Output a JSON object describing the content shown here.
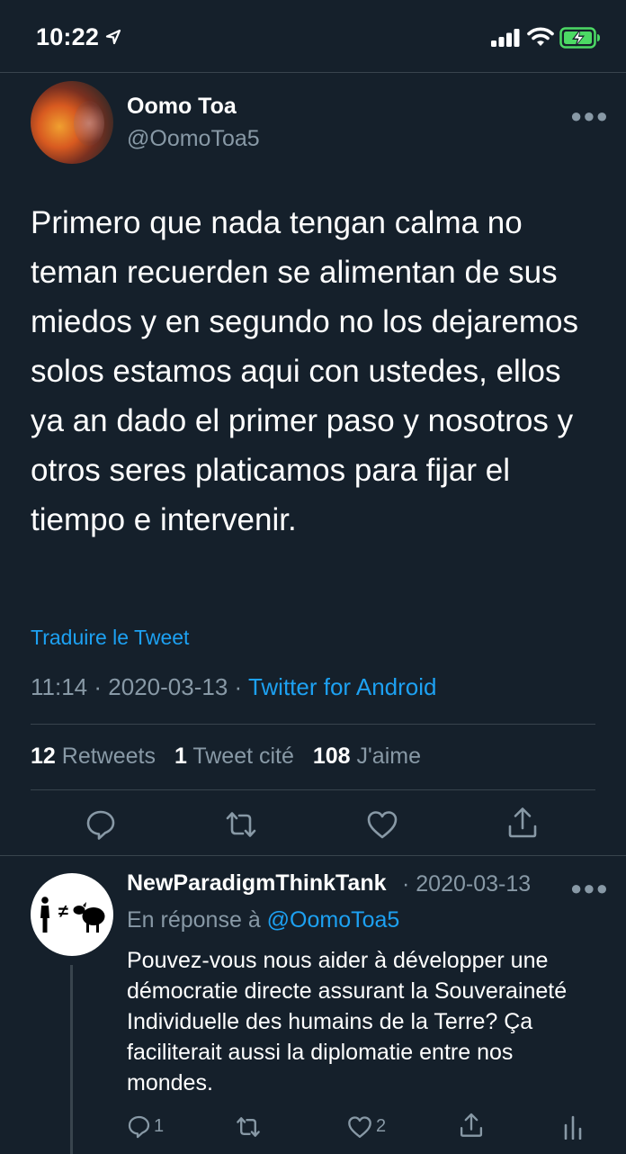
{
  "status_bar": {
    "time": "10:22",
    "icons": [
      "location-arrow-icon",
      "signal-icon",
      "wifi-icon",
      "battery-charging-icon"
    ]
  },
  "tweet": {
    "author_name": "Oomo Toa",
    "author_handle": "@OomoToa5",
    "text": "Primero que nada tengan calma no teman recuerden se alimentan de sus miedos y en segundo no los dejaremos solos estamos aqui con ustedes, ellos ya an dado el primer paso y nosotros y otros seres platicamos para fijar el tiempo e intervenir.",
    "translate_label": "Traduire le Tweet",
    "time": "11:14",
    "date": "2020-03-13",
    "separator": "·",
    "source": "Twitter for Android",
    "stats": {
      "retweets_count": "12",
      "retweets_label": "Retweets",
      "quotes_count": "1",
      "quotes_label": "Tweet cité",
      "likes_count": "108",
      "likes_label": "J'aime"
    },
    "actions": [
      "reply-icon",
      "retweet-icon",
      "like-icon",
      "share-icon"
    ]
  },
  "reply": {
    "author_name": "NewParadigmThinkTank",
    "date_text": "· 2020-03-13",
    "reply_to_prefix": "En réponse à",
    "reply_to_handle": "@OomoToa5",
    "text": "Pouvez-vous nous aider à développer une démocratie directe assurant la Souveraineté Individuelle des humains de la Terre? Ça faciliterait aussi la diplomatie entre nos mondes.",
    "avatar_symbol": "≠",
    "reply_count": "1",
    "like_count": "2",
    "actions": [
      "reply-icon",
      "retweet-icon",
      "like-icon",
      "share-icon",
      "analytics-icon"
    ]
  },
  "colors": {
    "background": "#15202b",
    "divider": "#38444d",
    "secondary_text": "#8899a6",
    "accent": "#1da1f2",
    "battery": "#4cd964"
  }
}
